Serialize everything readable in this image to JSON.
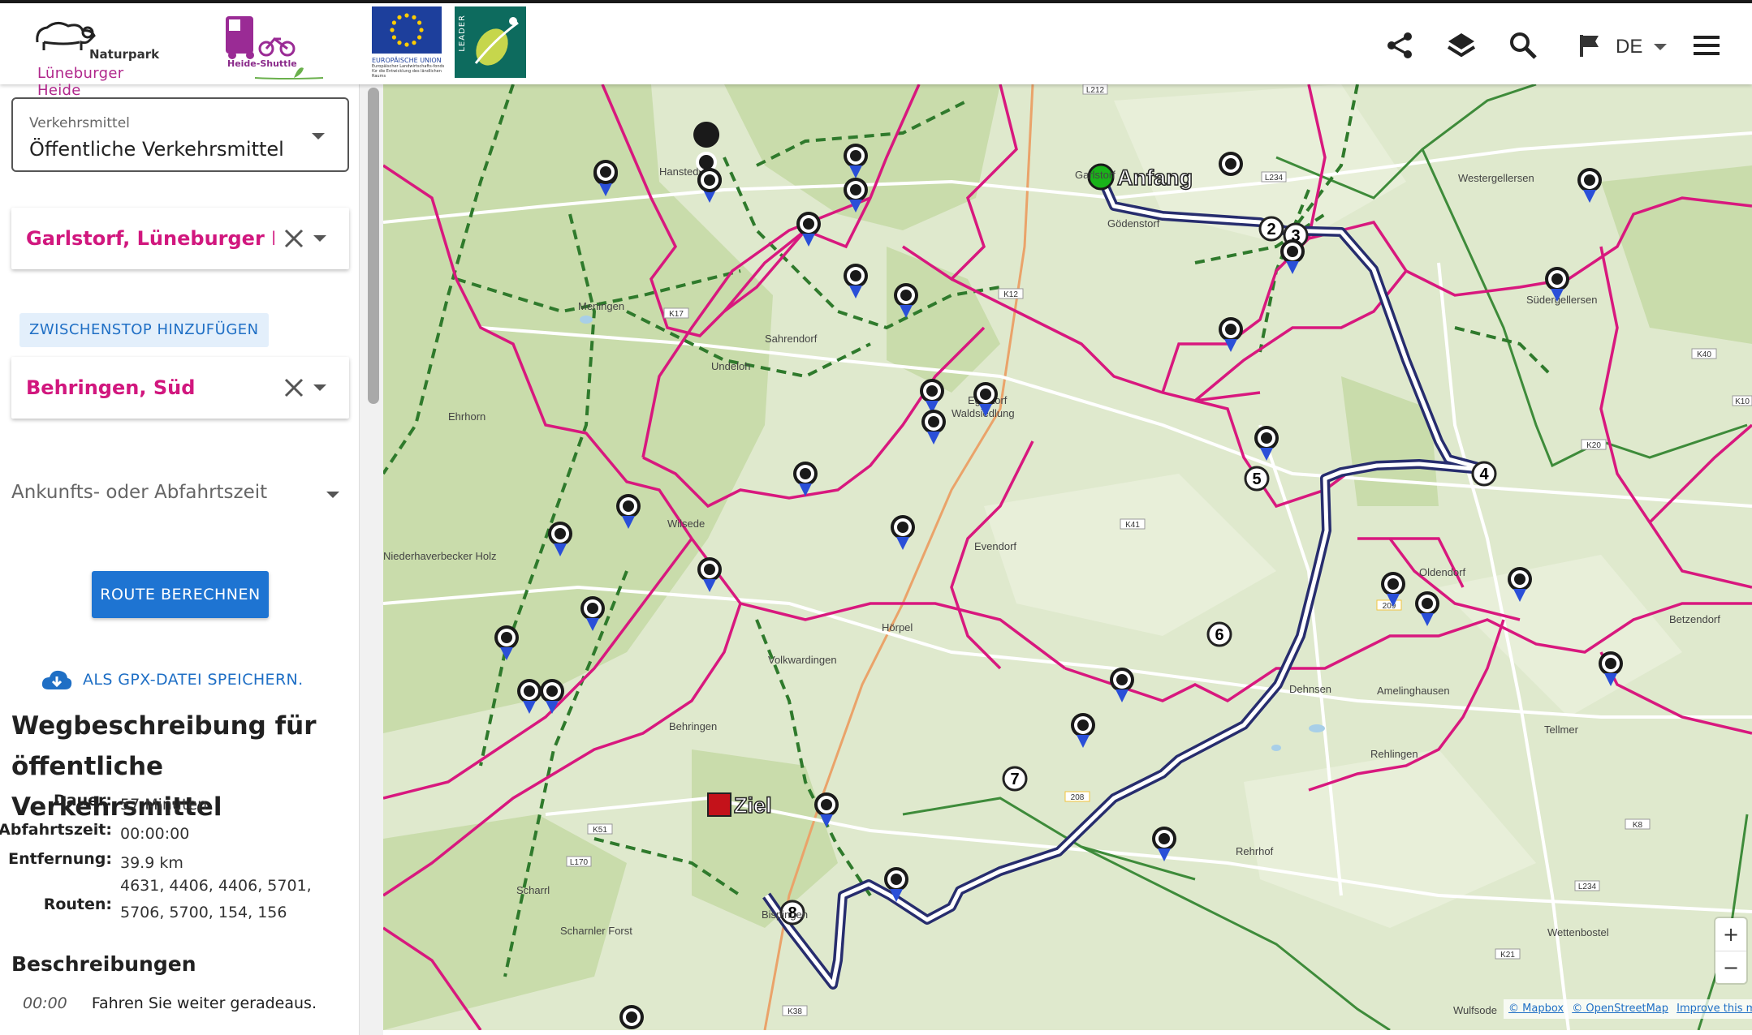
{
  "header": {
    "logo_naturpark": {
      "line1": "Naturpark",
      "line2": "Lüneburger Heide"
    },
    "logo_shuttle": {
      "text": "Heide-Shuttle"
    },
    "logo_eu": {
      "title": "EUROPÄISCHE UNION",
      "subtitle": "Europäischer Landwirtschafts-fonds für die Entwicklung des ländlichen Raums"
    },
    "logo_leader": {
      "text": "LEADER"
    },
    "language": "DE",
    "icons": [
      "share-icon",
      "layers-icon",
      "search-icon",
      "flag-icon",
      "menu-icon"
    ]
  },
  "sidebar": {
    "transport": {
      "label": "Verkehrsmittel",
      "value": "Öffentliche Verkehrsmittel"
    },
    "start": "Garlstorf, Lüneburger Land:",
    "add_stop": "ZWISCHENSTOP HINZUFÜGEN",
    "destination": "Behringen, Süd",
    "time_placeholder": "Ankunfts- oder Abfahrtszeit",
    "calculate": "ROUTE BERECHNEN",
    "gpx": "ALS GPX-DATEI SPEICHERN.",
    "directions_title": "Wegbeschreibung für öffentliche Verkehrsmittel",
    "details": {
      "duration_label": "Dauer:",
      "duration": "57 Minuten",
      "departure_label": "Abfahrtszeit:",
      "departure": "00:00:00",
      "distance_label": "Entfernung:",
      "distance": "39.9 km",
      "routes_label": "Routen:",
      "routes": "4631, 4406, 4406, 5701, 5706, 5700, 154, 156"
    },
    "descriptions_title": "Beschreibungen",
    "instructions": [
      {
        "time": "00:00",
        "text": "Fahren Sie weiter geradeaus."
      }
    ]
  },
  "map": {
    "start_label": "Anfang",
    "end_label": "Ziel",
    "waypoints": [
      "2",
      "3",
      "4",
      "5",
      "6",
      "7",
      "8"
    ],
    "places": [
      "Westergellersen",
      "Südergellersen",
      "Meningen",
      "Sahrendorf",
      "Undeloh",
      "Egestorf",
      "Waldsiedlung",
      "Ehrhorn",
      "Evendorf",
      "Volkwardingen",
      "Behringen",
      "Dehnsen",
      "Amelinghausen",
      "Rehlingen",
      "Tellmer",
      "Oldendorf",
      "Betzendorf",
      "Rehrhof",
      "Wettenbostel",
      "Wulfsode",
      "Scharrl",
      "Scharnler Forst",
      "Hörpel",
      "Bispingen",
      "Niederhaverbecker Holz",
      "Garlstorf",
      "Gödenstorf",
      "Hanstedt",
      "Wilsede"
    ],
    "road_labels": [
      "L212",
      "L234",
      "K17",
      "K12",
      "K41",
      "K51",
      "L170",
      "K38",
      "K20",
      "K10",
      "K8",
      "L234",
      "K21",
      "209",
      "208",
      "K40"
    ],
    "zoom_in": "+",
    "zoom_out": "−",
    "attribution": [
      "© Mapbox",
      "© OpenStreetMap",
      "Improve this map"
    ]
  }
}
